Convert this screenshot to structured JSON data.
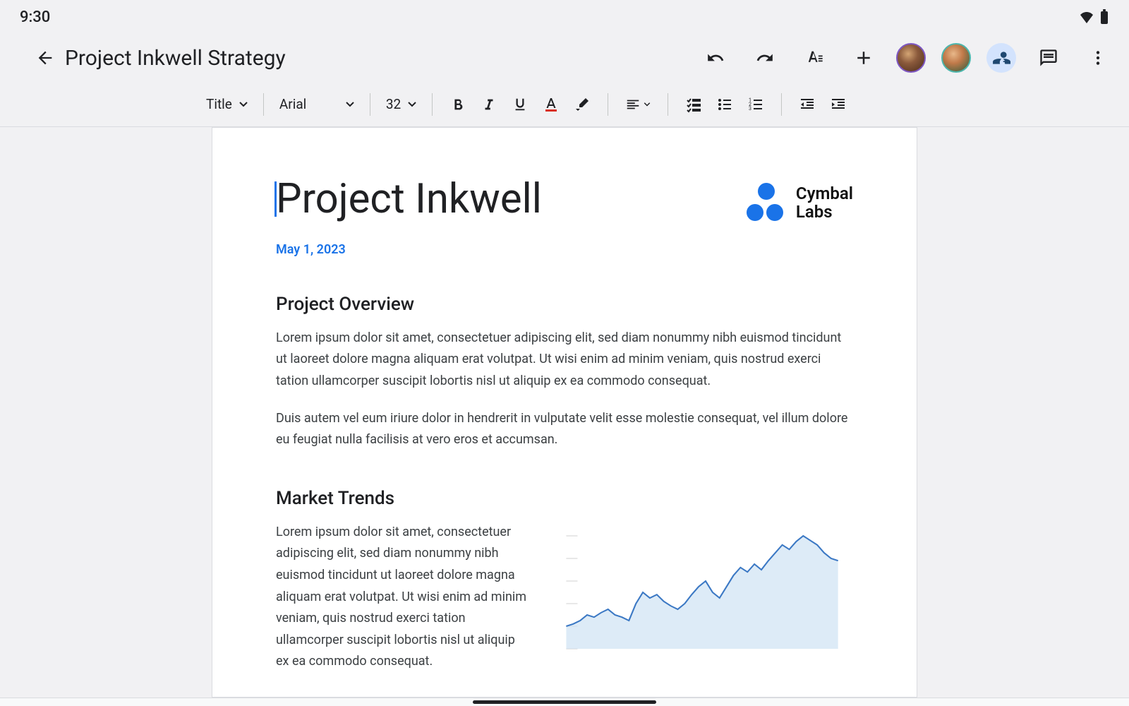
{
  "status": {
    "time": "9:30"
  },
  "appbar": {
    "title": "Project Inkwell Strategy"
  },
  "toolbar": {
    "style_select": "Title",
    "font_select": "Arial",
    "size_select": "32"
  },
  "document": {
    "title": "Project Inkwell",
    "date": "May 1, 2023",
    "logo": {
      "line1": "Cymbal",
      "line2": "Labs"
    },
    "sections": [
      {
        "heading": "Project Overview",
        "p1": "Lorem ipsum dolor sit amet, consectetuer adipiscing elit, sed diam nonummy nibh euismod tincidunt ut laoreet dolore magna aliquam erat volutpat. Ut wisi enim ad minim veniam, quis nostrud exerci tation ullamcorper suscipit lobortis nisl ut aliquip ex ea commodo consequat.",
        "p2": "Duis autem vel eum iriure dolor in hendrerit in vulputate velit esse molestie consequat, vel illum dolore eu feugiat nulla facilisis at vero eros et accumsan."
      },
      {
        "heading": "Market Trends",
        "p1": "Lorem ipsum dolor sit amet, consectetuer adipiscing elit, sed diam nonummy nibh euismod tincidunt ut laoreet dolore magna aliquam erat volutpat. Ut wisi enim ad minim veniam, quis nostrud exerci tation ullamcorper suscipit lobortis nisl ut aliquip ex ea commodo consequat."
      }
    ]
  },
  "chart_data": {
    "type": "area",
    "title": "",
    "xlabel": "",
    "ylabel": "",
    "x": [
      0,
      1,
      2,
      3,
      4,
      5,
      6,
      7,
      8,
      9,
      10,
      11,
      12,
      13,
      14,
      15,
      16,
      17,
      18,
      19,
      20,
      21,
      22,
      23,
      24,
      25,
      26,
      27,
      28,
      29,
      30,
      31,
      32,
      33,
      34,
      35,
      36,
      37,
      38,
      39
    ],
    "values": [
      20,
      22,
      25,
      30,
      28,
      32,
      35,
      30,
      28,
      25,
      40,
      50,
      45,
      48,
      42,
      38,
      35,
      40,
      48,
      55,
      60,
      50,
      45,
      55,
      65,
      72,
      68,
      75,
      70,
      78,
      85,
      92,
      88,
      95,
      100,
      96,
      92,
      85,
      80,
      78
    ],
    "ylim": [
      0,
      100
    ]
  }
}
